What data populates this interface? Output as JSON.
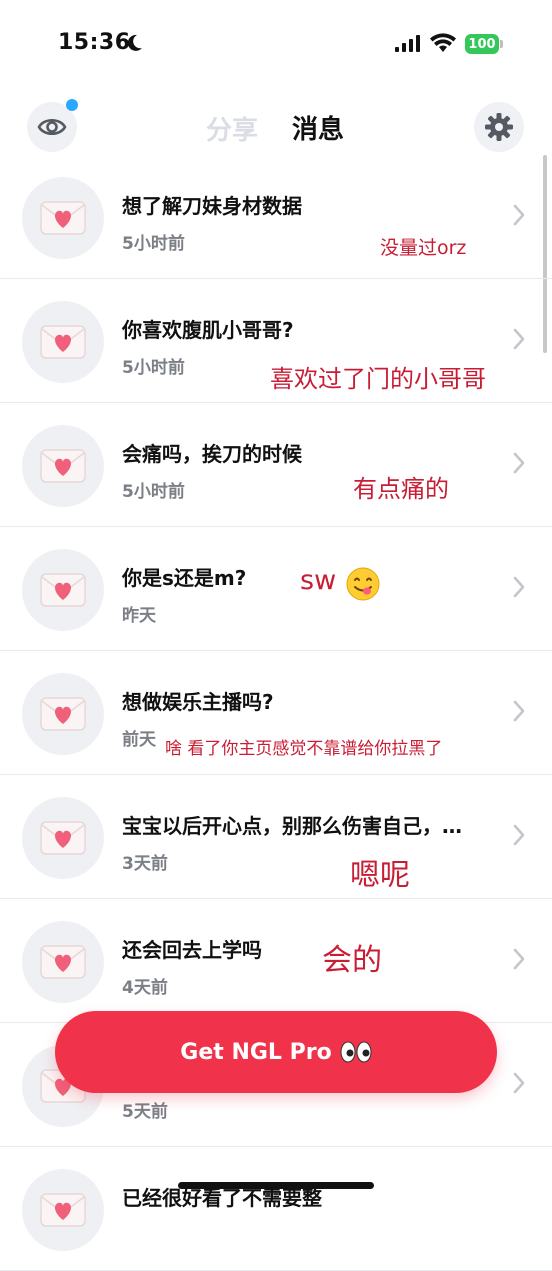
{
  "status_bar": {
    "time": "15:36",
    "battery": "100"
  },
  "header": {
    "tab_share": "分享",
    "tab_messages": "消息"
  },
  "messages": [
    {
      "text": "想了解刀妹身材数据",
      "time": "5小时前",
      "reply": "没量过orz"
    },
    {
      "text": "你喜欢腹肌小哥哥?",
      "time": "5小时前",
      "reply": "喜欢过了门的小哥哥"
    },
    {
      "text": "会痛吗，挨刀的时候",
      "time": "5小时前",
      "reply": "有点痛的"
    },
    {
      "text": "你是s还是m?",
      "time": "昨天",
      "reply": "sw"
    },
    {
      "text": "想做娱乐主播吗?",
      "time": "前天",
      "reply": "啥 看了你主页感觉不靠谱给你拉黑了"
    },
    {
      "text": "宝宝以后开心点，别那么伤害自己，…",
      "time": "3天前",
      "reply": "嗯呢"
    },
    {
      "text": "还会回去上学吗",
      "time": "4天前",
      "reply": "会的"
    },
    {
      "text": "",
      "time": "5天前",
      "reply": ""
    },
    {
      "text": "已经很好看了不需要整",
      "time": "",
      "reply": ""
    }
  ],
  "cta": {
    "label": "Get NGL Pro"
  },
  "colors": {
    "accent": "#f0324b",
    "reply": "#c81d35",
    "badge": "#2aa8ff",
    "battery": "#34c759"
  }
}
